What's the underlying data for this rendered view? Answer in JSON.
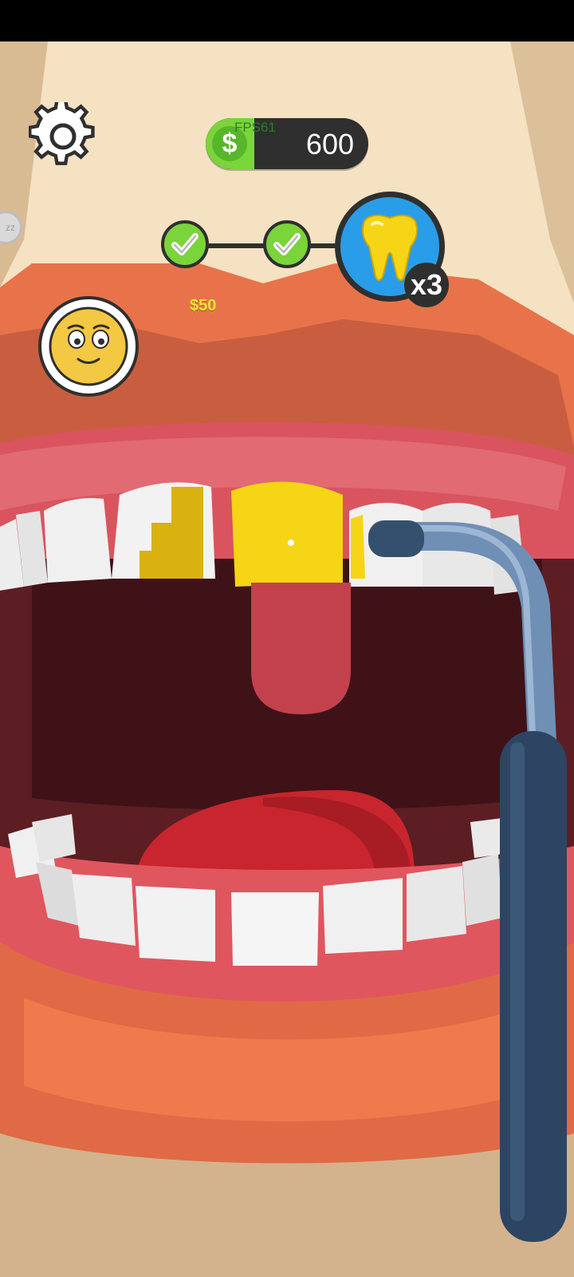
{
  "hud": {
    "fps_label": "FPS61",
    "currency_symbol": "$",
    "money": "600",
    "money_fill_fraction": 0.3,
    "reward": "$50",
    "multiplier": "x3",
    "side_button_label": "zz"
  },
  "progress": {
    "completed_steps": 2,
    "current_step_icon": "gold-tooth-icon"
  },
  "colors": {
    "accent_green": "#7bd43a",
    "accent_blue": "#2a9de8",
    "gold": "#f5d515",
    "hud_dark": "#2f2f2f"
  }
}
